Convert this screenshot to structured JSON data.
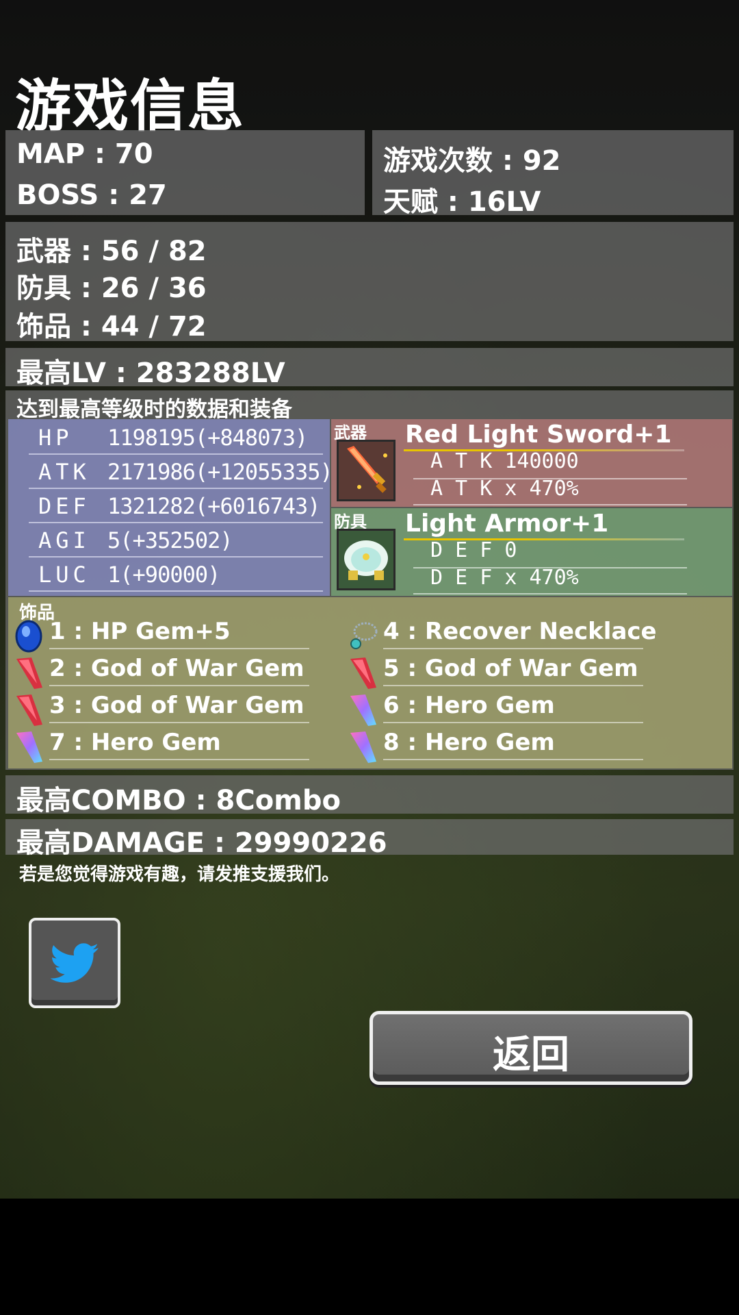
{
  "page": {
    "title": "游戏信息"
  },
  "summary": {
    "map": "MAP : 70",
    "boss": "BOSS : 27",
    "play_count": "游戏次数 : 92",
    "talent": "天赋 : 16LV"
  },
  "collection": {
    "weapons": "武器 : 56 / 82",
    "armor": "防具 : 26 / 36",
    "accessories": "饰品 : 44 / 72"
  },
  "max_level": "最高LV : 283288LV",
  "best_record": {
    "heading": "达到最高等级时的数据和装备",
    "stats": [
      {
        "key": "HP",
        "value": "1198195(+848073)"
      },
      {
        "key": "ATK",
        "value": "2171986(+12055335)"
      },
      {
        "key": "DEF",
        "value": "1321282(+6016743)"
      },
      {
        "key": "AGI",
        "value": "5(+352502)"
      },
      {
        "key": "LUC",
        "value": "1(+90000)"
      }
    ],
    "weapon": {
      "tag": "武器",
      "name": "Red Light Sword+1",
      "stat1": "A T K      140000",
      "stat2": "A T K  x   470%"
    },
    "armor": {
      "tag": "防具",
      "name": "Light Armor+1",
      "stat1": "D E F        0",
      "stat2": "D E F  x   470%"
    },
    "accessories": {
      "tag": "饰品",
      "items": [
        {
          "label": "1 : HP Gem+5",
          "icon": "blue-gem-icon"
        },
        {
          "label": "2 : God of War Gem",
          "icon": "red-crystal-icon"
        },
        {
          "label": "3 : God of War Gem",
          "icon": "red-crystal-icon"
        },
        {
          "label": "7 : Hero Gem",
          "icon": "rainbow-crystal-icon"
        },
        {
          "label": "4 : Recover Necklace",
          "icon": "necklace-icon"
        },
        {
          "label": "5 : God of War Gem",
          "icon": "red-crystal-icon"
        },
        {
          "label": "6 : Hero Gem",
          "icon": "rainbow-crystal-icon"
        },
        {
          "label": "8 : Hero Gem",
          "icon": "rainbow-crystal-icon"
        }
      ]
    }
  },
  "max_combo": "最高COMBO : 8Combo",
  "max_damage": "最高DAMAGE : 29990226",
  "notice": "若是您觉得游戏有趣，请发推支援我们。",
  "buttons": {
    "back": "返回",
    "twitter_icon": "twitter-bird-icon"
  },
  "colors": {
    "twitter_blue": "#1da1f2",
    "weapon_bg": "#be7878",
    "armor_bg": "#78aa78",
    "stats_bg": "#878cc8",
    "accessory_bg": "#aaaa6e"
  }
}
